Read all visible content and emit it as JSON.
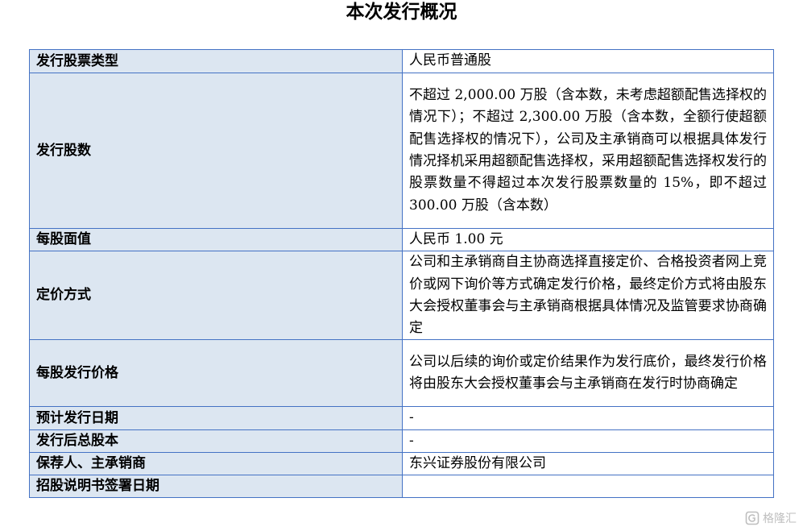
{
  "title": "本次发行概况",
  "rows": [
    {
      "label": "发行股票类型",
      "value": "人民币普通股"
    },
    {
      "label": "发行股数",
      "value": "不超过 2,000.00 万股（含本数，未考虑超额配售选择权的情况下）；不超过 2,300.00 万股（含本数，全额行使超额配售选择权的情况下），公司及主承销商可以根据具体发行情况择机采用超额配售选择权，采用超额配售选择权发行的股票数量不得超过本次发行股票数量的 15%，即不超过 300.00 万股（含本数）"
    },
    {
      "label": "每股面值",
      "value": "人民币 1.00 元"
    },
    {
      "label": "定价方式",
      "value": "公司和主承销商自主协商选择直接定价、合格投资者网上竞价或网下询价等方式确定发行价格，最终定价方式将由股东大会授权董事会与主承销商根据具体情况及监管要求协商确定"
    },
    {
      "label": "每股发行价格",
      "value": "公司以后续的询价或定价结果作为发行底价，最终发行价格将由股东大会授权董事会与主承销商在发行时协商确定"
    },
    {
      "label": "预计发行日期",
      "value": "-"
    },
    {
      "label": "发行后总股本",
      "value": "-"
    },
    {
      "label": "保荐人、主承销商",
      "value": "东兴证券股份有限公司"
    },
    {
      "label": "招股说明书签署日期",
      "value": ""
    }
  ],
  "watermark": {
    "text": "格隆汇",
    "icon": "logo-icon"
  }
}
